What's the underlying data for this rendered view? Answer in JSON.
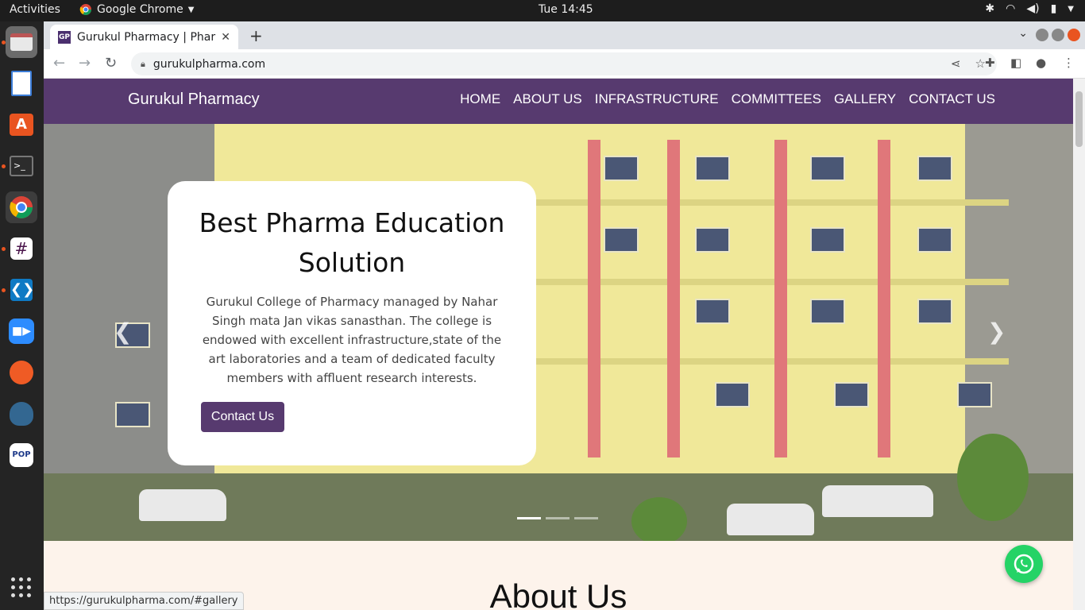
{
  "topbar": {
    "activities": "Activities",
    "app_name": "Google Chrome",
    "clock": "Tue 14:45"
  },
  "dock": {
    "items": [
      "files-icon",
      "image-viewer-icon",
      "software-center-icon",
      "terminal-icon",
      "chrome-icon",
      "slack-icon",
      "vscode-icon",
      "zoom-icon",
      "postman-icon",
      "pgadmin-icon",
      "popsql-icon"
    ]
  },
  "browser": {
    "tab_title": "Gurukul Pharmacy | Pharm",
    "tab_favicon": "GP",
    "new_tab": "+",
    "url": "gurukulpharma.com",
    "status_url": "https://gurukulpharma.com/#gallery"
  },
  "site": {
    "brand": "Gurukul Pharmacy",
    "nav": [
      "HOME",
      "ABOUT US",
      "INFRASTRUCTURE",
      "COMMITTEES",
      "GALLERY",
      "CONTACT US"
    ],
    "hero": {
      "heading": "Best Pharma Education Solution",
      "text": "Gurukul College of Pharmacy managed by Nahar Singh mata Jan vikas sanasthan. The college is endowed with excellent infrastructure,state of the art laboratories and a team of dedicated faculty members with affluent research interests.",
      "button": "Contact Us",
      "slides": 3,
      "active_slide": 1
    },
    "about_heading": "About Us"
  },
  "colors": {
    "brand_purple": "#573a6f",
    "whatsapp_green": "#25d366"
  }
}
